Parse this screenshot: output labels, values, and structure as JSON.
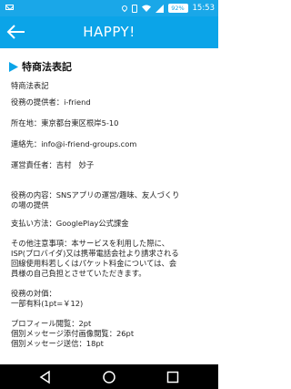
{
  "status": {
    "battery": "92%",
    "time": "15:53"
  },
  "header": {
    "title": "HAPPY!"
  },
  "section": {
    "title": "特商法表記"
  },
  "lines": [
    "特商法表記",
    "役務の提供者：i-friend",
    "所在地：東京都台東区根岸5-10",
    "連絡先：info@i-friend-groups.com",
    "運営責任者：吉村　妙子",
    "役務の内容：SNSアプリの運営/趣味、友人づくり",
    "の場の提供",
    "支払い方法：GooglePlay公式課金",
    "その他注意事項：本サービスを利用した際に、",
    "ISP(プロバイダ)又は携帯電話会社より請求される",
    "回線使用料若しくはパケット料金については、会",
    "員様の自己負担とさせていただきます。",
    "役務の対価：",
    "一部有料(1pt=￥12)",
    "プロフィール閲覧：2pt",
    "個別メッセージ添付画像閲覧：26pt",
    "個別メッセージ送信：18pt"
  ]
}
